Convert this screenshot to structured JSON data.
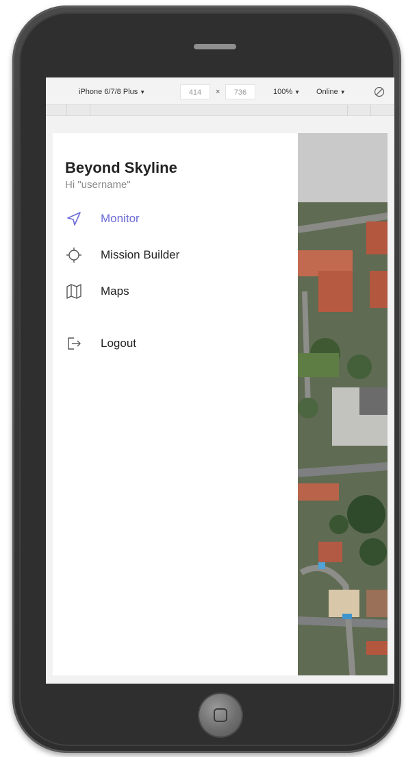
{
  "devtools": {
    "device": "iPhone 6/7/8 Plus",
    "width": "414",
    "times": "×",
    "height": "736",
    "zoom": "100%",
    "network": "Online"
  },
  "drawer": {
    "title": "Beyond Skyline",
    "greeting": "Hi \"username\"",
    "items": [
      {
        "label": "Monitor",
        "icon": "navigation-arrow-icon",
        "active": true
      },
      {
        "label": "Mission Builder",
        "icon": "crosshair-icon",
        "active": false
      },
      {
        "label": "Maps",
        "icon": "map-icon",
        "active": false
      },
      {
        "label": "Logout",
        "icon": "logout-icon",
        "active": false
      }
    ]
  },
  "colors": {
    "accent": "#6b6bd6",
    "phone_body": "#3a3a3a"
  }
}
